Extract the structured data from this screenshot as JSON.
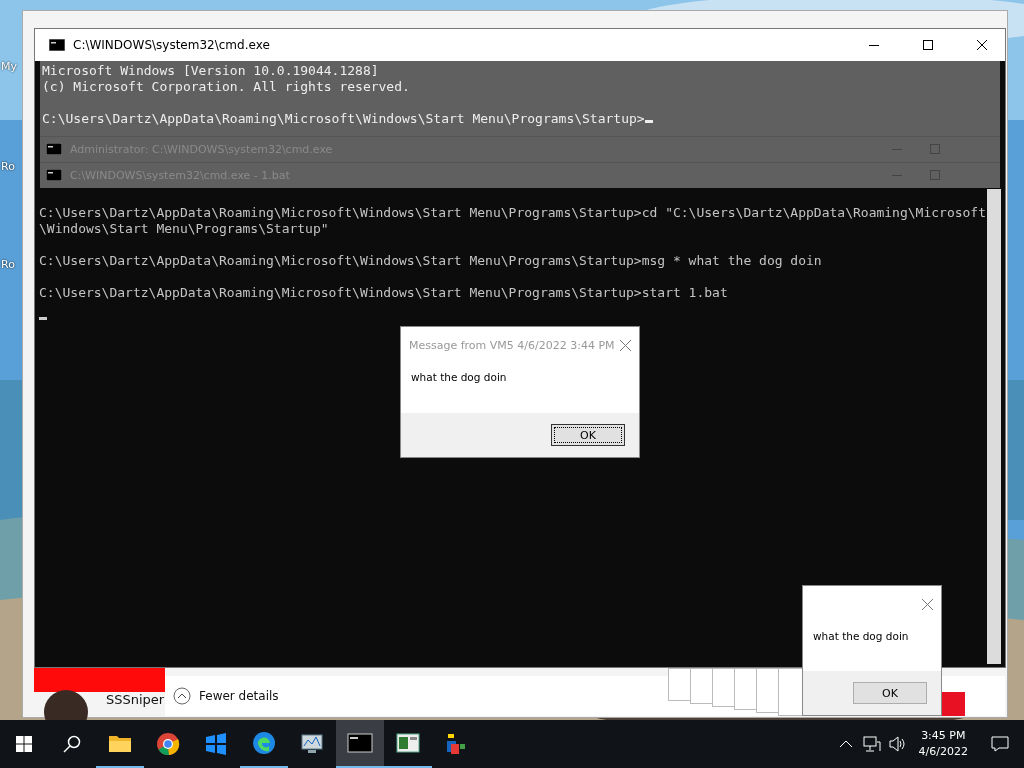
{
  "desktop": {
    "icon_labels": [
      "My",
      "Ro",
      "Ro"
    ]
  },
  "console_window": {
    "title": "C:\\WINDOWS\\system32\\cmd.exe",
    "header_lines": [
      "Microsoft Windows [Version 10.0.19044.1288]",
      "(c) Microsoft Corporation. All rights reserved.",
      "C:\\Users\\Dartz\\AppData\\Roaming\\Microsoft\\Windows\\Start Menu\\Programs\\Startup>"
    ],
    "stacked_titles": [
      "Administrator: C:\\WINDOWS\\system32\\cmd.exe",
      "C:\\WINDOWS\\system32\\cmd.exe - 1.bat"
    ],
    "lines": [
      "C:\\Users\\Dartz\\AppData\\Roaming\\Microsoft\\Windows\\Start Menu\\Programs\\Startup>cd \"C:\\Users\\Dartz\\AppData\\Roaming\\Microsoft\\Windows\\Start Menu\\Programs\\Startup\"",
      "C:\\Users\\Dartz\\AppData\\Roaming\\Microsoft\\Windows\\Start Menu\\Programs\\Startup>msg * what the dog doin",
      "C:\\Users\\Dartz\\AppData\\Roaming\\Microsoft\\Windows\\Start Menu\\Programs\\Startup>start 1.bat"
    ]
  },
  "message_dialog": {
    "title": "Message from VM5 4/6/2022 3:44 PM",
    "text": "what the dog doin",
    "button": "OK"
  },
  "small_dialog": {
    "text": "what the dog doin",
    "button": "OK"
  },
  "task_manager": {
    "toggle": "Fewer details",
    "user": "SSSniper"
  },
  "taskbar": {
    "apps": [
      {
        "kind": "folder",
        "running": true,
        "selected": false
      },
      {
        "kind": "chrome",
        "running": false,
        "selected": false
      },
      {
        "kind": "tiles",
        "running": false,
        "selected": false
      },
      {
        "kind": "edge",
        "running": true,
        "selected": false
      },
      {
        "kind": "monitor",
        "running": false,
        "selected": false
      },
      {
        "kind": "console",
        "running": true,
        "selected": true
      },
      {
        "kind": "window",
        "running": true,
        "selected": false
      },
      {
        "kind": "blocks",
        "running": false,
        "selected": false
      }
    ],
    "time": "3:45 PM",
    "date": "4/6/2022"
  }
}
